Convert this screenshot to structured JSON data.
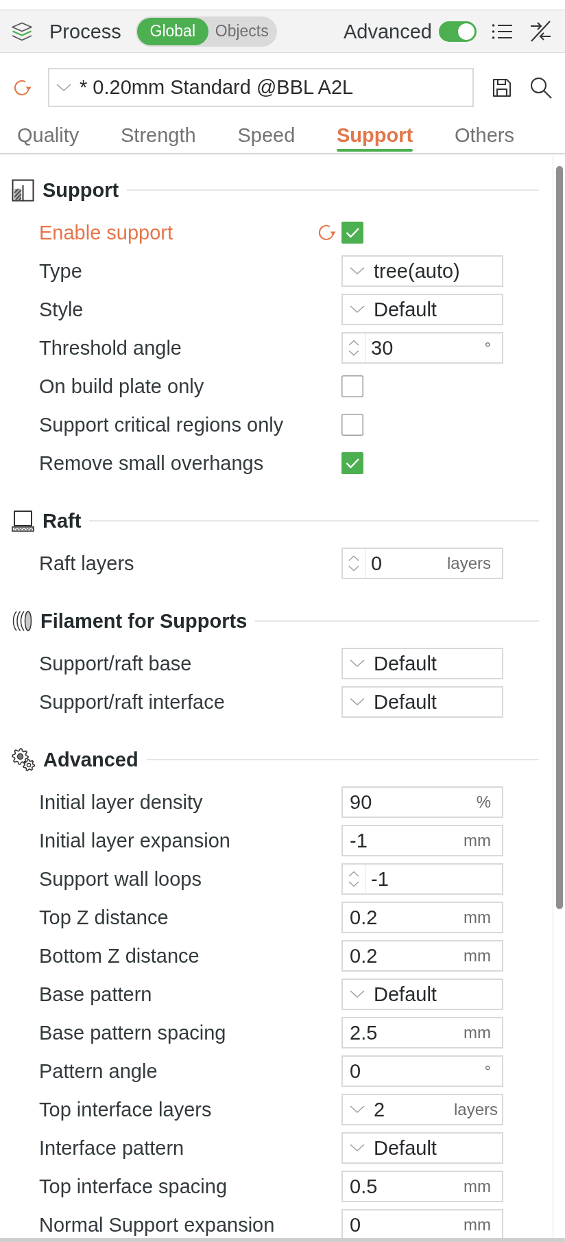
{
  "header": {
    "title": "Process",
    "scope_switch": [
      {
        "label": "Global",
        "selected": true
      },
      {
        "label": "Objects",
        "selected": false
      }
    ],
    "advanced_toggle": {
      "label": "Advanced",
      "on": true
    }
  },
  "preset": {
    "value": "* 0.20mm Standard @BBL A2L",
    "modified": true
  },
  "tabs": [
    {
      "label": "Quality",
      "selected": false
    },
    {
      "label": "Strength",
      "selected": false
    },
    {
      "label": "Speed",
      "selected": false
    },
    {
      "label": "Support",
      "selected": true
    },
    {
      "label": "Others",
      "selected": false
    }
  ],
  "sections": [
    {
      "title": "Support",
      "rows": [
        {
          "kind": "checkbox",
          "label": "Enable support",
          "modified": true,
          "checked": true
        },
        {
          "kind": "dropdown",
          "label": "Type",
          "modified": false,
          "value": "tree(auto)"
        },
        {
          "kind": "dropdown",
          "label": "Style",
          "modified": false,
          "value": "Default"
        },
        {
          "kind": "spin",
          "label": "Threshold angle",
          "modified": false,
          "value": "30",
          "unit": "°"
        },
        {
          "kind": "checkbox",
          "label": "On build plate only",
          "modified": false,
          "checked": false
        },
        {
          "kind": "checkbox",
          "label": "Support critical regions only",
          "modified": false,
          "checked": false
        },
        {
          "kind": "checkbox",
          "label": "Remove small overhangs",
          "modified": false,
          "checked": true
        }
      ]
    },
    {
      "title": "Raft",
      "rows": [
        {
          "kind": "spin",
          "label": "Raft layers",
          "modified": false,
          "value": "0",
          "unit": "layers"
        }
      ]
    },
    {
      "title": "Filament for Supports",
      "rows": [
        {
          "kind": "dropdown",
          "label": "Support/raft base",
          "modified": false,
          "value": "Default"
        },
        {
          "kind": "dropdown",
          "label": "Support/raft interface",
          "modified": false,
          "value": "Default"
        }
      ]
    },
    {
      "title": "Advanced",
      "rows": [
        {
          "kind": "text",
          "label": "Initial layer density",
          "modified": false,
          "value": "90",
          "unit": "%"
        },
        {
          "kind": "text",
          "label": "Initial layer expansion",
          "modified": false,
          "value": "-1",
          "unit": "mm"
        },
        {
          "kind": "spin",
          "label": "Support wall loops",
          "modified": false,
          "value": "-1"
        },
        {
          "kind": "text",
          "label": "Top Z distance",
          "modified": false,
          "value": "0.2",
          "unit": "mm"
        },
        {
          "kind": "text",
          "label": "Bottom Z distance",
          "modified": false,
          "value": "0.2",
          "unit": "mm"
        },
        {
          "kind": "dropdown",
          "label": "Base pattern",
          "modified": false,
          "value": "Default"
        },
        {
          "kind": "text",
          "label": "Base pattern spacing",
          "modified": false,
          "value": "2.5",
          "unit": "mm"
        },
        {
          "kind": "text",
          "label": "Pattern angle",
          "modified": false,
          "value": "0",
          "unit": "°"
        },
        {
          "kind": "dropdown",
          "label": "Top interface layers",
          "modified": false,
          "value": "2",
          "unit": "layers"
        },
        {
          "kind": "dropdown",
          "label": "Interface pattern",
          "modified": false,
          "value": "Default"
        },
        {
          "kind": "text",
          "label": "Top interface spacing",
          "modified": false,
          "value": "0.5",
          "unit": "mm"
        },
        {
          "kind": "text",
          "label": "Normal Support expansion",
          "modified": false,
          "value": "0",
          "unit": "mm"
        }
      ]
    }
  ]
}
